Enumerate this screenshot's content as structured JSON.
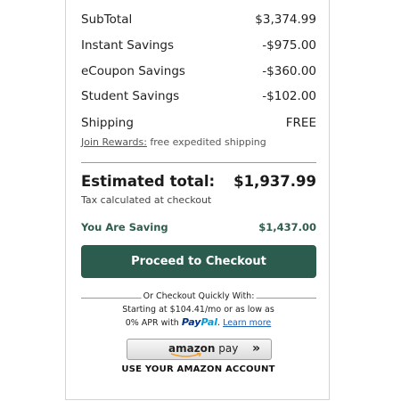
{
  "summary": {
    "rows": [
      {
        "label": "SubTotal",
        "value": "$3,374.99"
      },
      {
        "label": "Instant Savings",
        "value": "-$975.00"
      },
      {
        "label": "eCoupon Savings",
        "value": "-$360.00"
      },
      {
        "label": "Student Savings",
        "value": "-$102.00"
      },
      {
        "label": "Shipping",
        "value": "FREE"
      }
    ],
    "rewards_link": "Join Rewards:",
    "rewards_text": " free expedited shipping"
  },
  "total": {
    "label": "Estimated total:",
    "value": "$1,937.99",
    "tax_note": "Tax calculated at checkout"
  },
  "saving": {
    "label": "You Are Saving",
    "value": "$1,437.00",
    "color": "#2f5d4c"
  },
  "checkout": {
    "button_label": "Proceed to Checkout",
    "button_color": "#2b5c4d"
  },
  "quick_checkout": {
    "heading": "Or Checkout Quickly With:",
    "paypal_line1": "Starting at $104.41/mo or as low as",
    "paypal_line2_prefix": "0% APR with ",
    "paypal_brand_pay": "Pay",
    "paypal_brand_pal": "Pal",
    "learn_more": "Learn more"
  },
  "amazon": {
    "logo_bold": "amazon",
    "logo_rest": " pay",
    "chevron_icon": "double-chevron-right-icon",
    "caption": "USE YOUR AMAZON ACCOUNT"
  }
}
